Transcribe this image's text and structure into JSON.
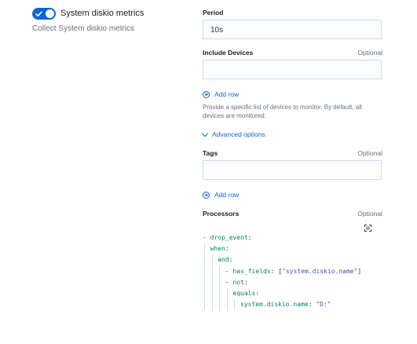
{
  "integration": {
    "toggle_on": true,
    "title": "System diskio metrics",
    "description": "Collect System diskio metrics"
  },
  "period": {
    "label": "Period",
    "value": "10s"
  },
  "include_devices": {
    "label": "Include Devices",
    "optional": "Optional",
    "value": "",
    "add_row": "Add row",
    "help": "Provide a specific list of devices to monitor. By default, all devices are monitored."
  },
  "advanced_options": {
    "label": "Advanced options"
  },
  "tags": {
    "label": "Tags",
    "optional": "Optional",
    "value": "",
    "add_row": "Add row"
  },
  "processors": {
    "label": "Processors",
    "optional": "Optional",
    "fullscreen_icon": "fullscreen-icon",
    "code_lines": [
      {
        "indent": 0,
        "dash": true,
        "key": "drop_event",
        "sep": ":",
        "value": ""
      },
      {
        "indent": 1,
        "dash": false,
        "key": "when",
        "sep": ":",
        "value": ""
      },
      {
        "indent": 2,
        "dash": false,
        "key": "and",
        "sep": ":",
        "value": ""
      },
      {
        "indent": 3,
        "dash": true,
        "key": "has_fields",
        "sep": ": ",
        "value": "[\"system.diskio.name\"]"
      },
      {
        "indent": 3,
        "dash": true,
        "key": "not",
        "sep": ":",
        "value": ""
      },
      {
        "indent": 4,
        "dash": false,
        "key": "equals",
        "sep": ":",
        "value": ""
      },
      {
        "indent": 5,
        "dash": false,
        "key": "system.diskio.name",
        "sep": ": ",
        "value": "\"D:\""
      }
    ]
  },
  "colors": {
    "accent": "#0b64dd",
    "yaml_key": "#00806b",
    "yaml_string": "#3c56b4"
  }
}
